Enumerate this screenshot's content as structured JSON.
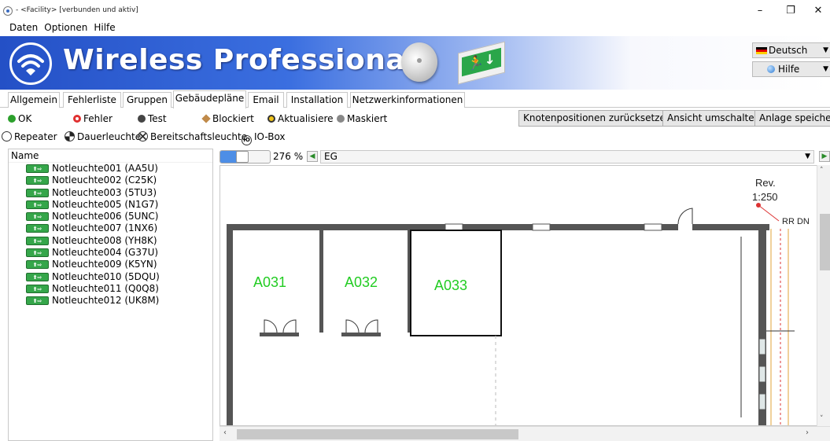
{
  "window": {
    "title": "- <Facility> [verbunden und aktiv]",
    "minimize": "–",
    "maximize": "❐",
    "close": "✕"
  },
  "menu": [
    "Daten",
    "Optionen",
    "Hilfe"
  ],
  "banner": {
    "brand": "Wireless Professional",
    "language": "Deutsch",
    "help": "Hilfe",
    "caret": "▼",
    "exit_sign_glyph": "🏃↓"
  },
  "tabs": [
    "Allgemein",
    "Fehlerliste",
    "Gruppen",
    "Gebäudepläne",
    "Email",
    "Installation",
    "Netzwerkinformationen"
  ],
  "active_tab": "Gebäudepläne",
  "status_legend": {
    "ok": "OK",
    "fehler": "Fehler",
    "test": "Test",
    "blockiert": "Blockiert",
    "aktualisiere": "Aktualisiere",
    "maskiert": "Maskiert"
  },
  "status_colors": {
    "ok": "#2ca02c",
    "fehler": "#e03030",
    "test": "#444444",
    "blockiert": "#c08a4a",
    "aktualisiere": "#f0c419",
    "maskiert": "#888888"
  },
  "actions": {
    "reset_positions": "Knotenpositionen zurücksetzen",
    "toggle_view": "Ansicht umschalten",
    "save": "Anlage speichern"
  },
  "device_types": {
    "repeater": "Repeater",
    "dauerleuchte": "Dauerleuchte",
    "bereitschaftsleuchte": "Bereitschaftsleuchte",
    "iobox": "IO-Box",
    "iobox_glyph": "IO"
  },
  "tree": {
    "header": "Name",
    "lamp_label": "⬆⇨",
    "items": [
      "Notleuchte001 (AA5U)",
      "Notleuchte002 (C25K)",
      "Notleuchte003 (5TU3)",
      "Notleuchte005 (N1G7)",
      "Notleuchte006 (5UNC)",
      "Notleuchte007 (1NX6)",
      "Notleuchte008 (YH8K)",
      "Notleuchte004 (G37U)",
      "Notleuchte009 (K5YN)",
      "Notleuchte010 (5DQU)",
      "Notleuchte011 (Q0Q8)",
      "Notleuchte012 (UK8M)"
    ]
  },
  "floor": {
    "zoom": "276 %",
    "level": "EG",
    "prev": "◀",
    "next": "▶",
    "rooms": [
      "A031",
      "A032",
      "A033"
    ],
    "room_color": "#22cc22",
    "rev_label": "Rev.",
    "scale_label": "1:250",
    "rr_label": "RR DN"
  },
  "scroll": {
    "up": "˄",
    "down": "˅",
    "left": "‹",
    "right": "›"
  }
}
